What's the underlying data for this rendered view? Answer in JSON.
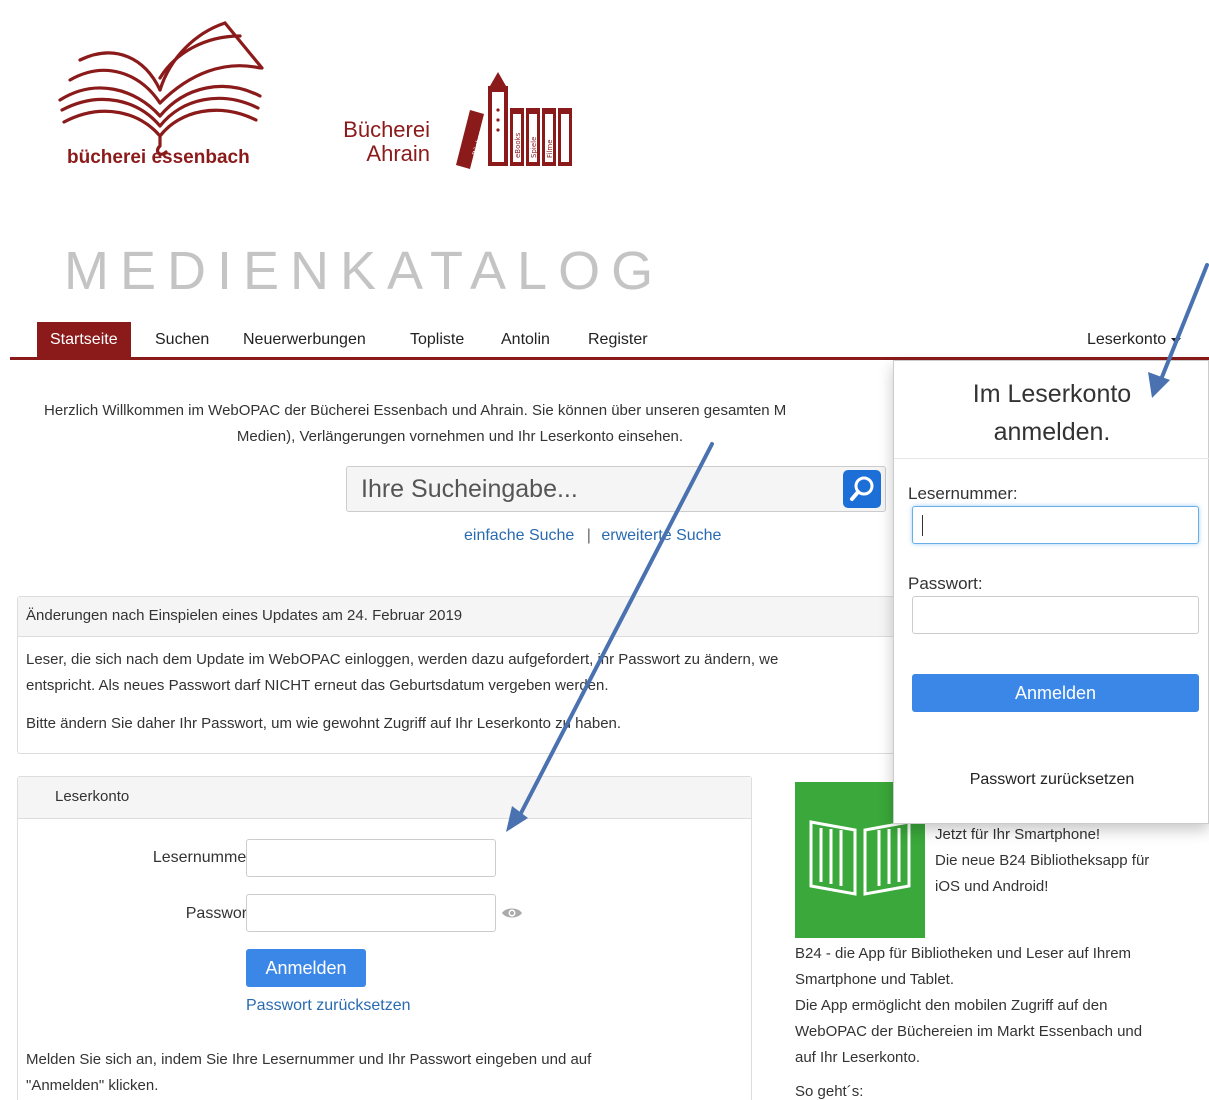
{
  "logos": {
    "essenbach": "bücherei essenbach",
    "ahrain_line1": "Bücherei",
    "ahrain_line2": "Ahrain",
    "book_spines": [
      "Bücher",
      "eBooks",
      "Spiele",
      "Filme"
    ]
  },
  "header": {
    "title": "MEDIENKATALOG"
  },
  "nav": {
    "items": [
      {
        "label": "Startseite",
        "active": true
      },
      {
        "label": "Suchen"
      },
      {
        "label": "Neuerwerbungen"
      },
      {
        "label": "Topliste"
      },
      {
        "label": "Antolin"
      },
      {
        "label": "Register"
      }
    ],
    "account": "Leserkonto"
  },
  "welcome": {
    "line1": "Herzlich Willkommen im WebOPAC der Bücherei Essenbach und Ahrain. Sie können über unseren gesamten M",
    "line2": "Medien), Verlängerungen vornehmen und Ihr Leserkonto einsehen."
  },
  "search": {
    "placeholder": "Ihre Sucheingabe...",
    "simple_link": "einfache Suche",
    "separator": "|",
    "advanced_link": "erweiterte Suche"
  },
  "info": {
    "heading": "Änderungen nach Einspielen eines Updates am 24. Februar 2019",
    "line1": "Leser, die sich nach dem Update im WebOPAC einloggen, werden dazu aufgefordert, ihr Passwort zu ändern, we",
    "line2": "entspricht. Als neues Passwort darf NICHT erneut das Geburtsdatum vergeben werden.",
    "line3": "Bitte ändern Sie daher Ihr Passwort, um wie gewohnt Zugriff auf Ihr Leserkonto zu haben."
  },
  "login": {
    "heading": "Leserkonto",
    "reader_label": "Lesernummer:",
    "password_label": "Passwort:",
    "submit": "Anmelden",
    "reset": "Passwort zurücksetzen",
    "note_line1": "Melden Sie sich an, indem Sie Ihre Lesernummer und Ihr Passwort eingeben und auf",
    "note_line2": "\"Anmelden\" klicken."
  },
  "app": {
    "line1": "Jetzt für Ihr Smartphone!",
    "line2": "Die neue B24 Bibliotheksapp für",
    "line3": "iOS und Android!",
    "desc1": "B24 - die App für Bibliotheken und Leser auf Ihrem",
    "desc2": "Smartphone und Tablet.",
    "desc3": "Die App ermöglicht den mobilen Zugriff auf den",
    "desc4": "WebOPAC der Büchereien im Markt Essenbach und",
    "desc5": "auf Ihr Leserkonto.",
    "howto": "So geht´s:"
  },
  "dropdown": {
    "title_line1": "Im Leserkonto",
    "title_line2": "anmelden.",
    "reader_label": "Lesernummer:",
    "password_label": "Passwort:",
    "submit": "Anmelden",
    "reset": "Passwort zurücksetzen"
  },
  "colors": {
    "brand": "#8b1a1a",
    "primary": "#3b87e8",
    "link": "#2a6ab0",
    "app_green": "#3aa83a"
  }
}
